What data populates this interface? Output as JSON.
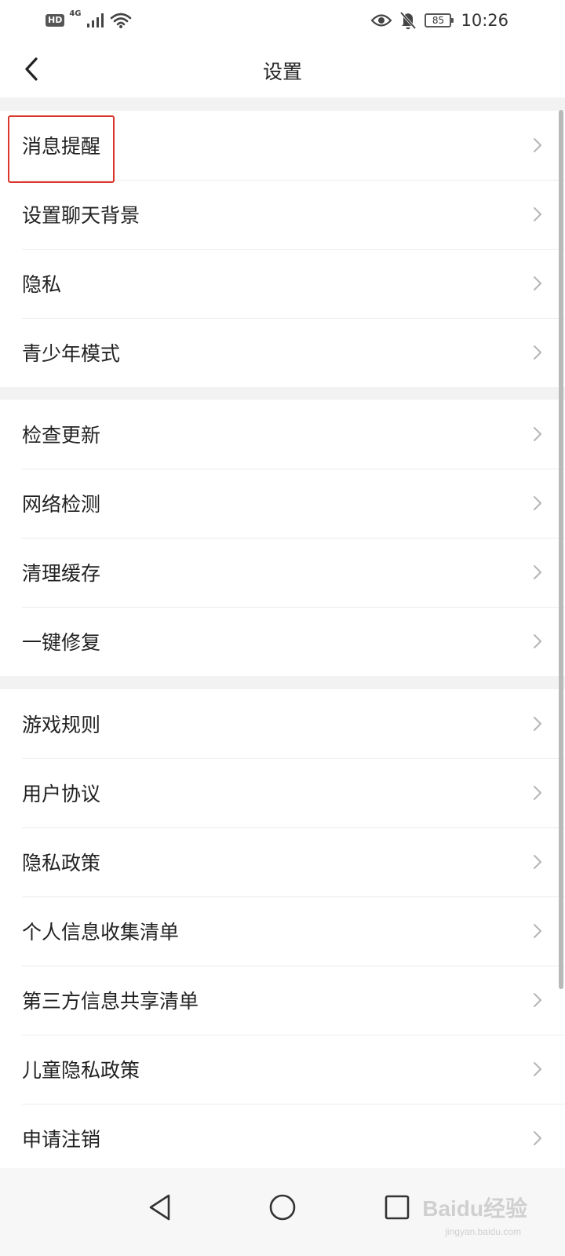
{
  "status_bar": {
    "hd": "HD",
    "network": "4G",
    "battery": "85",
    "time": "10:26",
    "icons": [
      "signal-icon",
      "wifi-icon",
      "eye-icon",
      "bell-off-icon",
      "battery-icon"
    ]
  },
  "header": {
    "title": "设置",
    "back_icon": "chevron-left-icon"
  },
  "groups": [
    {
      "items": [
        {
          "label": "消息提醒",
          "highlighted": true
        },
        {
          "label": "设置聊天背景"
        },
        {
          "label": "隐私"
        },
        {
          "label": "青少年模式"
        }
      ]
    },
    {
      "items": [
        {
          "label": "检查更新"
        },
        {
          "label": "网络检测"
        },
        {
          "label": "清理缓存"
        },
        {
          "label": "一键修复"
        }
      ]
    },
    {
      "items": [
        {
          "label": "游戏规则"
        },
        {
          "label": "用户协议"
        },
        {
          "label": "隐私政策"
        },
        {
          "label": "个人信息收集清单"
        },
        {
          "label": "第三方信息共享清单"
        },
        {
          "label": "儿童隐私政策"
        },
        {
          "label": "申请注销"
        }
      ]
    }
  ],
  "system_nav": {
    "icons": [
      "back-triangle-icon",
      "home-circle-icon",
      "recents-square-icon"
    ]
  },
  "watermark": {
    "text": "Baidu经验",
    "sub": "jingyan.baidu.com"
  },
  "colors": {
    "highlight": "#d9352b",
    "divider": "#ececec",
    "background": "#f2f2f2"
  }
}
